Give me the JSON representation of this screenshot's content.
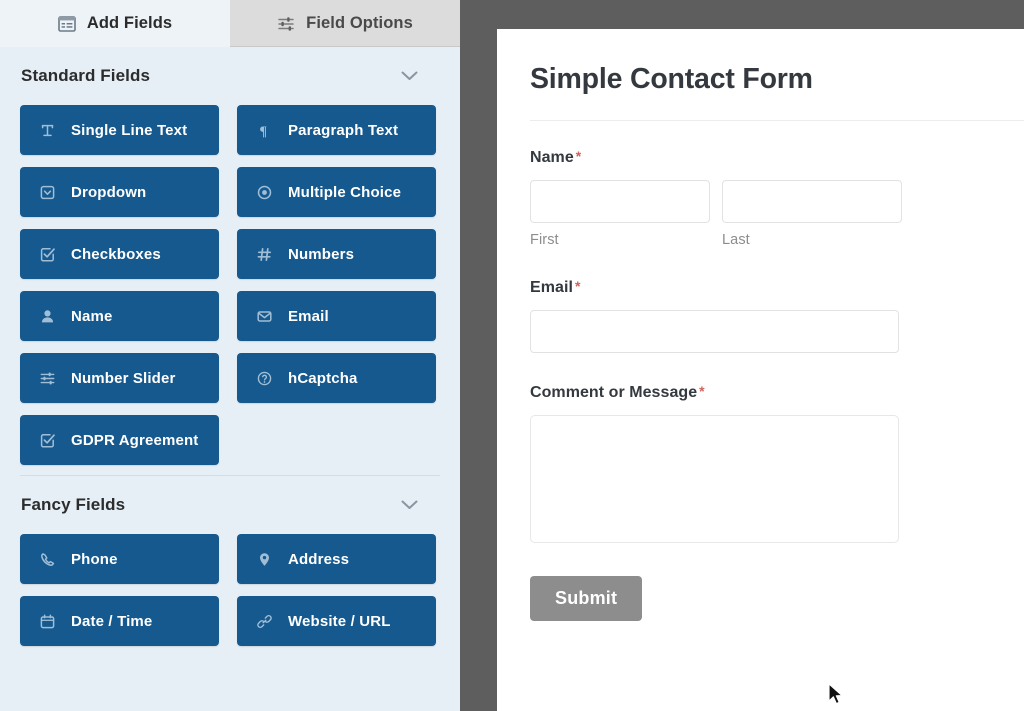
{
  "builder": {
    "tabs": [
      {
        "id": "add-fields",
        "label": "Add Fields",
        "icon": "panels-icon",
        "active": true
      },
      {
        "id": "field-options",
        "label": "Field Options",
        "icon": "sliders-icon",
        "active": false
      }
    ],
    "sections": [
      {
        "id": "standard-fields",
        "title": "Standard Fields",
        "toggle_icon": "chevron-down-icon",
        "fields": [
          {
            "label": "Single Line Text",
            "icon": "text-cursor-icon"
          },
          {
            "label": "Paragraph Text",
            "icon": "paragraph-icon"
          },
          {
            "label": "Dropdown",
            "icon": "dropdown-icon"
          },
          {
            "label": "Multiple Choice",
            "icon": "radio-icon"
          },
          {
            "label": "Checkboxes",
            "icon": "checkbox-icon"
          },
          {
            "label": "Numbers",
            "icon": "hash-icon"
          },
          {
            "label": "Name",
            "icon": "user-icon"
          },
          {
            "label": "Email",
            "icon": "envelope-icon"
          },
          {
            "label": "Number Slider",
            "icon": "sliders-icon"
          },
          {
            "label": "hCaptcha",
            "icon": "question-circle-icon"
          },
          {
            "label": "GDPR Agreement",
            "icon": "checkbox-icon"
          }
        ]
      },
      {
        "id": "fancy-fields",
        "title": "Fancy Fields",
        "toggle_icon": "chevron-down-icon",
        "fields": [
          {
            "label": "Phone",
            "icon": "phone-icon"
          },
          {
            "label": "Address",
            "icon": "map-pin-icon"
          },
          {
            "label": "Date / Time",
            "icon": "calendar-icon"
          },
          {
            "label": "Website / URL",
            "icon": "link-icon"
          }
        ]
      }
    ]
  },
  "preview": {
    "form_title": "Simple Contact Form",
    "required_marker": "*",
    "fields": [
      {
        "id": "name",
        "label": "Name",
        "required": true,
        "type": "name",
        "parts": [
          {
            "id": "first",
            "sublabel": "First",
            "value": "",
            "placeholder": ""
          },
          {
            "id": "last",
            "sublabel": "Last",
            "value": "",
            "placeholder": ""
          }
        ]
      },
      {
        "id": "email",
        "label": "Email",
        "required": true,
        "type": "text",
        "value": "",
        "placeholder": ""
      },
      {
        "id": "comment",
        "label": "Comment or Message",
        "required": true,
        "type": "textarea",
        "value": "",
        "placeholder": ""
      }
    ],
    "submit_label": "Submit"
  },
  "colors": {
    "field_button": "#15598f",
    "sidebar_bg": "#e6eef6",
    "backdrop": "#5e5e5e",
    "submit_button": "#8d8d8d",
    "required_marker": "#d4605a",
    "active_tab_bg": "#eef3f8",
    "inactive_tab_bg": "#dcdcdc"
  }
}
